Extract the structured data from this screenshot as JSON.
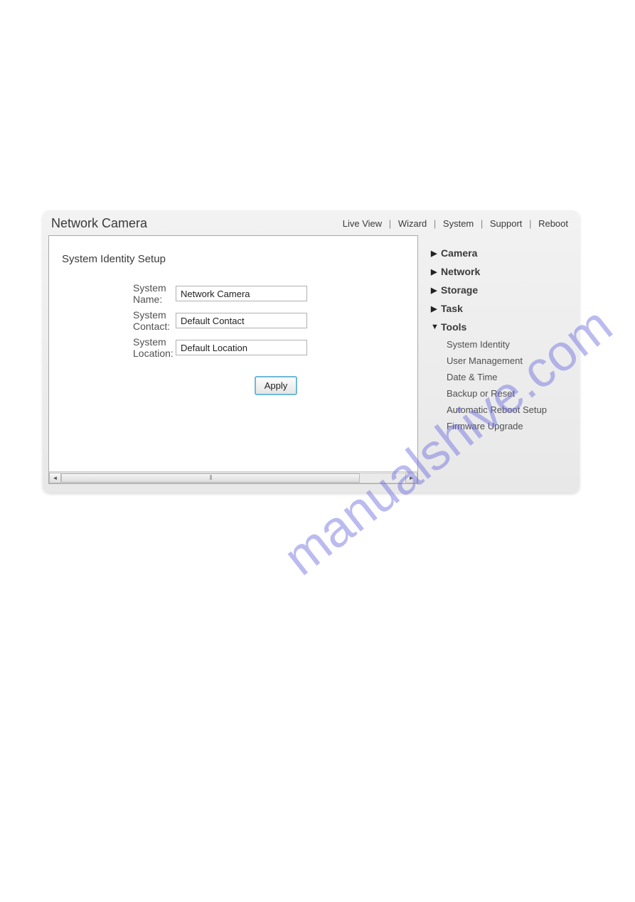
{
  "watermark": "manualshive.com",
  "header": {
    "title": "Network Camera",
    "links": [
      "Live View",
      "Wizard",
      "System",
      "Support",
      "Reboot"
    ]
  },
  "content": {
    "title": "System Identity Setup",
    "fields": {
      "system_name": {
        "label": "System Name:",
        "value": "Network Camera"
      },
      "system_contact": {
        "label": "System Contact:",
        "value": "Default Contact"
      },
      "system_location": {
        "label": "System Location:",
        "value": "Default Location"
      }
    },
    "apply_label": "Apply"
  },
  "sidebar": {
    "categories": [
      {
        "label": "Camera",
        "expanded": false
      },
      {
        "label": "Network",
        "expanded": false
      },
      {
        "label": "Storage",
        "expanded": false
      },
      {
        "label": "Task",
        "expanded": false
      },
      {
        "label": "Tools",
        "expanded": true
      }
    ],
    "tools_items": [
      "System Identity",
      "User Management",
      "Date & Time",
      "Backup or Reset",
      "Automatic Reboot Setup",
      "Firmware Upgrade"
    ]
  }
}
